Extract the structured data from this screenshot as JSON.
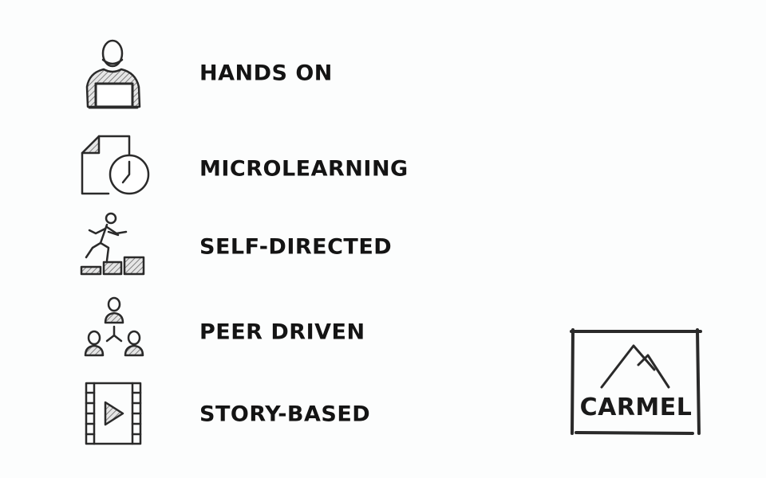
{
  "items": [
    {
      "label": "HANDS ON",
      "icon": "person-laptop-icon"
    },
    {
      "label": "MICROLEARNING",
      "icon": "document-clock-icon"
    },
    {
      "label": "SELF-DIRECTED",
      "icon": "climbing-steps-icon"
    },
    {
      "label": "PEER DRIVEN",
      "icon": "peer-network-icon"
    },
    {
      "label": "STORY-BASED",
      "icon": "video-film-icon"
    }
  ],
  "logo": {
    "text": "CARMEL"
  },
  "colors": {
    "ink": "#2a2a2a",
    "background": "#fcfdfd",
    "hatch": "#8a8a8a"
  }
}
